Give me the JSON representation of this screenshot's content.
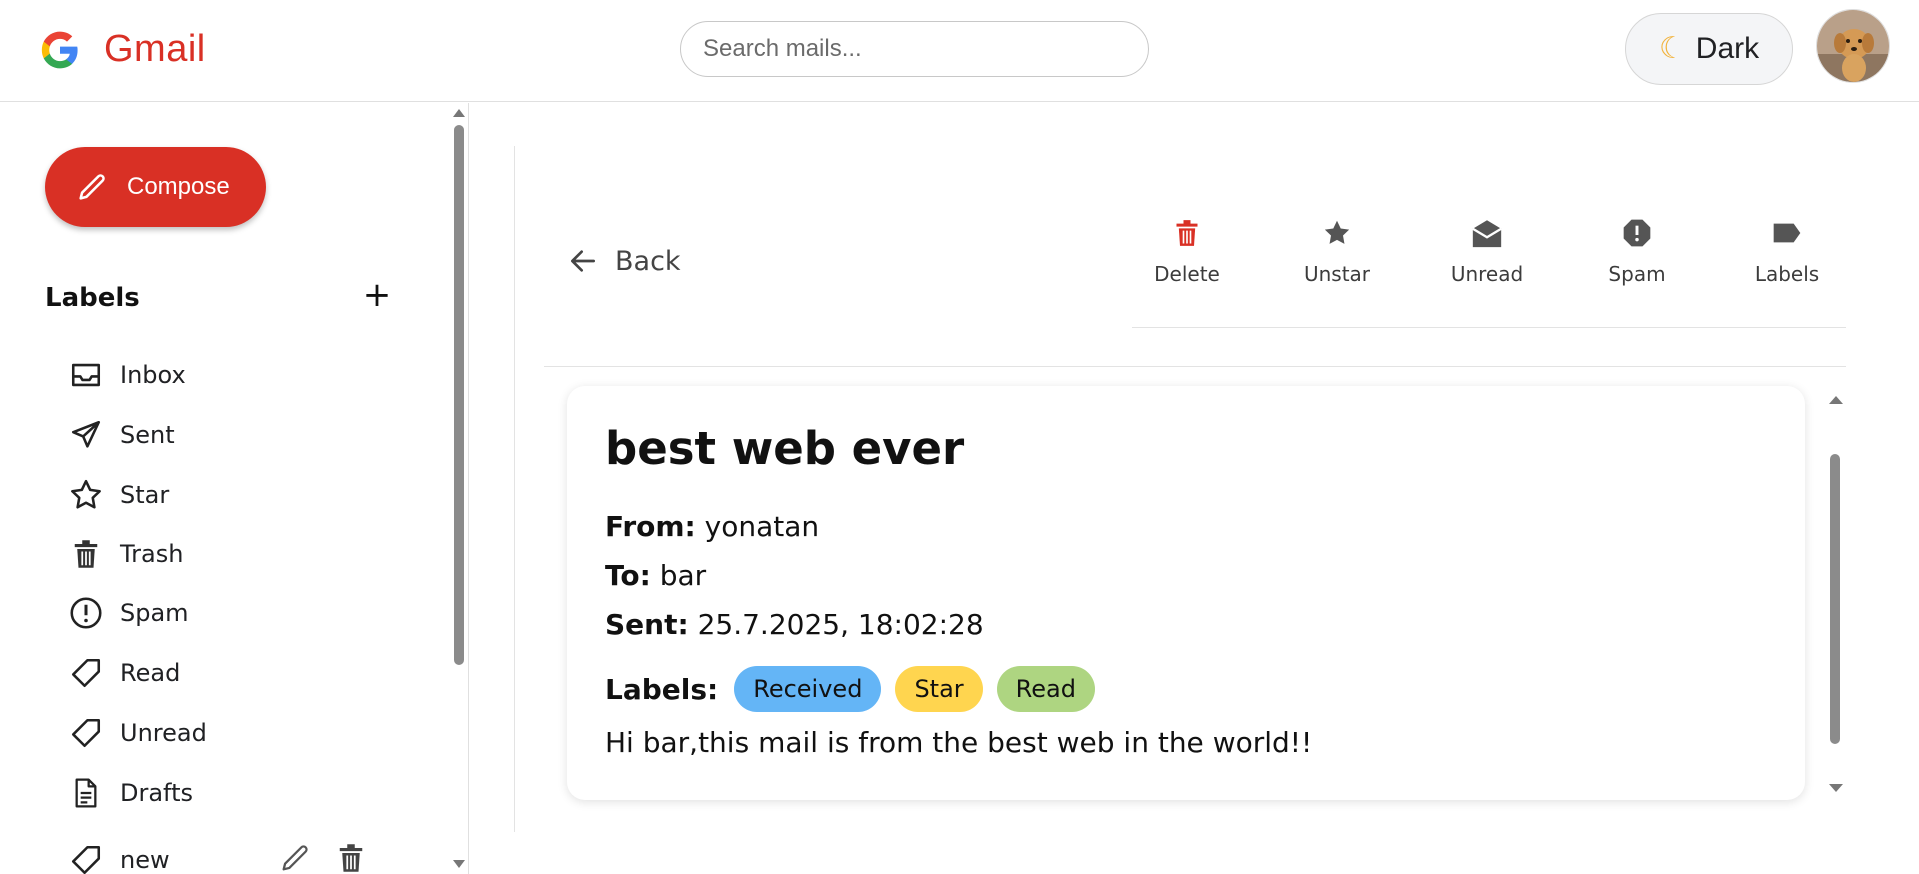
{
  "header": {
    "app_name": "Gmail",
    "search_placeholder": "Search mails...",
    "theme_toggle_label": "Dark",
    "theme_toggle_icon": "moon-icon",
    "brand_color": "#d93025"
  },
  "sidebar": {
    "compose_label": "Compose",
    "labels_heading": "Labels",
    "add_label": "+",
    "items": [
      {
        "label": "Inbox",
        "icon": "inbox-icon"
      },
      {
        "label": "Sent",
        "icon": "send-icon"
      },
      {
        "label": "Star",
        "icon": "star-icon"
      },
      {
        "label": "Trash",
        "icon": "trash-icon"
      },
      {
        "label": "Spam",
        "icon": "spam-icon"
      },
      {
        "label": "Read",
        "icon": "label-icon"
      },
      {
        "label": "Unread",
        "icon": "label-icon"
      },
      {
        "label": "Drafts",
        "icon": "draft-icon"
      },
      {
        "label": "new",
        "icon": "label-icon"
      }
    ]
  },
  "mail_view": {
    "back_label": "Back",
    "toolbar": [
      {
        "label": "Delete",
        "icon": "trash-icon",
        "color": "#d93025"
      },
      {
        "label": "Unstar",
        "icon": "star-icon",
        "color": "#555555"
      },
      {
        "label": "Unread",
        "icon": "mark-unread-icon",
        "color": "#555555"
      },
      {
        "label": "Spam",
        "icon": "report-spam-icon",
        "color": "#555555"
      },
      {
        "label": "Labels",
        "icon": "label-icon",
        "color": "#555555"
      }
    ],
    "mail": {
      "subject": "best web ever",
      "from_label": "From:",
      "from": "yonatan",
      "to_label": "To:",
      "to": "bar",
      "sent_label": "Sent:",
      "sent": "25.7.2025, 18:02:28",
      "labels_label": "Labels:",
      "labels": [
        {
          "name": "Received",
          "color": "#64b5f6"
        },
        {
          "name": "Star",
          "color": "#ffd54f"
        },
        {
          "name": "Read",
          "color": "#aed581"
        }
      ],
      "body": "Hi bar,this mail is from the best web in the world!!"
    }
  }
}
